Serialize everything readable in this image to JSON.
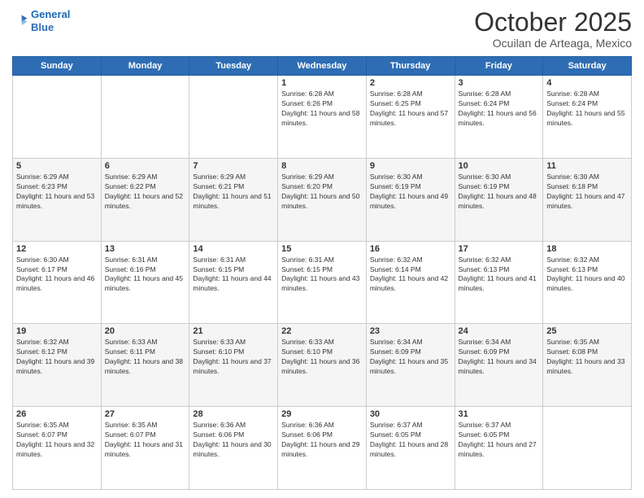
{
  "header": {
    "logo_line1": "General",
    "logo_line2": "Blue",
    "month": "October 2025",
    "location": "Ocuilan de Arteaga, Mexico"
  },
  "days_of_week": [
    "Sunday",
    "Monday",
    "Tuesday",
    "Wednesday",
    "Thursday",
    "Friday",
    "Saturday"
  ],
  "weeks": [
    [
      {
        "day": "",
        "sunrise": "",
        "sunset": "",
        "daylight": ""
      },
      {
        "day": "",
        "sunrise": "",
        "sunset": "",
        "daylight": ""
      },
      {
        "day": "",
        "sunrise": "",
        "sunset": "",
        "daylight": ""
      },
      {
        "day": "1",
        "sunrise": "Sunrise: 6:28 AM",
        "sunset": "Sunset: 6:26 PM",
        "daylight": "Daylight: 11 hours and 58 minutes."
      },
      {
        "day": "2",
        "sunrise": "Sunrise: 6:28 AM",
        "sunset": "Sunset: 6:25 PM",
        "daylight": "Daylight: 11 hours and 57 minutes."
      },
      {
        "day": "3",
        "sunrise": "Sunrise: 6:28 AM",
        "sunset": "Sunset: 6:24 PM",
        "daylight": "Daylight: 11 hours and 56 minutes."
      },
      {
        "day": "4",
        "sunrise": "Sunrise: 6:28 AM",
        "sunset": "Sunset: 6:24 PM",
        "daylight": "Daylight: 11 hours and 55 minutes."
      }
    ],
    [
      {
        "day": "5",
        "sunrise": "Sunrise: 6:29 AM",
        "sunset": "Sunset: 6:23 PM",
        "daylight": "Daylight: 11 hours and 53 minutes."
      },
      {
        "day": "6",
        "sunrise": "Sunrise: 6:29 AM",
        "sunset": "Sunset: 6:22 PM",
        "daylight": "Daylight: 11 hours and 52 minutes."
      },
      {
        "day": "7",
        "sunrise": "Sunrise: 6:29 AM",
        "sunset": "Sunset: 6:21 PM",
        "daylight": "Daylight: 11 hours and 51 minutes."
      },
      {
        "day": "8",
        "sunrise": "Sunrise: 6:29 AM",
        "sunset": "Sunset: 6:20 PM",
        "daylight": "Daylight: 11 hours and 50 minutes."
      },
      {
        "day": "9",
        "sunrise": "Sunrise: 6:30 AM",
        "sunset": "Sunset: 6:19 PM",
        "daylight": "Daylight: 11 hours and 49 minutes."
      },
      {
        "day": "10",
        "sunrise": "Sunrise: 6:30 AM",
        "sunset": "Sunset: 6:19 PM",
        "daylight": "Daylight: 11 hours and 48 minutes."
      },
      {
        "day": "11",
        "sunrise": "Sunrise: 6:30 AM",
        "sunset": "Sunset: 6:18 PM",
        "daylight": "Daylight: 11 hours and 47 minutes."
      }
    ],
    [
      {
        "day": "12",
        "sunrise": "Sunrise: 6:30 AM",
        "sunset": "Sunset: 6:17 PM",
        "daylight": "Daylight: 11 hours and 46 minutes."
      },
      {
        "day": "13",
        "sunrise": "Sunrise: 6:31 AM",
        "sunset": "Sunset: 6:16 PM",
        "daylight": "Daylight: 11 hours and 45 minutes."
      },
      {
        "day": "14",
        "sunrise": "Sunrise: 6:31 AM",
        "sunset": "Sunset: 6:15 PM",
        "daylight": "Daylight: 11 hours and 44 minutes."
      },
      {
        "day": "15",
        "sunrise": "Sunrise: 6:31 AM",
        "sunset": "Sunset: 6:15 PM",
        "daylight": "Daylight: 11 hours and 43 minutes."
      },
      {
        "day": "16",
        "sunrise": "Sunrise: 6:32 AM",
        "sunset": "Sunset: 6:14 PM",
        "daylight": "Daylight: 11 hours and 42 minutes."
      },
      {
        "day": "17",
        "sunrise": "Sunrise: 6:32 AM",
        "sunset": "Sunset: 6:13 PM",
        "daylight": "Daylight: 11 hours and 41 minutes."
      },
      {
        "day": "18",
        "sunrise": "Sunrise: 6:32 AM",
        "sunset": "Sunset: 6:13 PM",
        "daylight": "Daylight: 11 hours and 40 minutes."
      }
    ],
    [
      {
        "day": "19",
        "sunrise": "Sunrise: 6:32 AM",
        "sunset": "Sunset: 6:12 PM",
        "daylight": "Daylight: 11 hours and 39 minutes."
      },
      {
        "day": "20",
        "sunrise": "Sunrise: 6:33 AM",
        "sunset": "Sunset: 6:11 PM",
        "daylight": "Daylight: 11 hours and 38 minutes."
      },
      {
        "day": "21",
        "sunrise": "Sunrise: 6:33 AM",
        "sunset": "Sunset: 6:10 PM",
        "daylight": "Daylight: 11 hours and 37 minutes."
      },
      {
        "day": "22",
        "sunrise": "Sunrise: 6:33 AM",
        "sunset": "Sunset: 6:10 PM",
        "daylight": "Daylight: 11 hours and 36 minutes."
      },
      {
        "day": "23",
        "sunrise": "Sunrise: 6:34 AM",
        "sunset": "Sunset: 6:09 PM",
        "daylight": "Daylight: 11 hours and 35 minutes."
      },
      {
        "day": "24",
        "sunrise": "Sunrise: 6:34 AM",
        "sunset": "Sunset: 6:09 PM",
        "daylight": "Daylight: 11 hours and 34 minutes."
      },
      {
        "day": "25",
        "sunrise": "Sunrise: 6:35 AM",
        "sunset": "Sunset: 6:08 PM",
        "daylight": "Daylight: 11 hours and 33 minutes."
      }
    ],
    [
      {
        "day": "26",
        "sunrise": "Sunrise: 6:35 AM",
        "sunset": "Sunset: 6:07 PM",
        "daylight": "Daylight: 11 hours and 32 minutes."
      },
      {
        "day": "27",
        "sunrise": "Sunrise: 6:35 AM",
        "sunset": "Sunset: 6:07 PM",
        "daylight": "Daylight: 11 hours and 31 minutes."
      },
      {
        "day": "28",
        "sunrise": "Sunrise: 6:36 AM",
        "sunset": "Sunset: 6:06 PM",
        "daylight": "Daylight: 11 hours and 30 minutes."
      },
      {
        "day": "29",
        "sunrise": "Sunrise: 6:36 AM",
        "sunset": "Sunset: 6:06 PM",
        "daylight": "Daylight: 11 hours and 29 minutes."
      },
      {
        "day": "30",
        "sunrise": "Sunrise: 6:37 AM",
        "sunset": "Sunset: 6:05 PM",
        "daylight": "Daylight: 11 hours and 28 minutes."
      },
      {
        "day": "31",
        "sunrise": "Sunrise: 6:37 AM",
        "sunset": "Sunset: 6:05 PM",
        "daylight": "Daylight: 11 hours and 27 minutes."
      },
      {
        "day": "",
        "sunrise": "",
        "sunset": "",
        "daylight": ""
      }
    ]
  ]
}
